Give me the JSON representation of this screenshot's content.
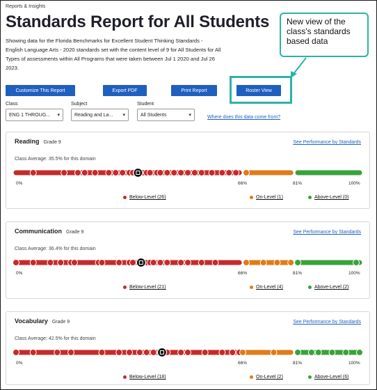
{
  "breadcrumb": "Reports & Insights",
  "title": "Standards Report for All Students",
  "description": "Showing data for the Florida Benchmarks for Excellent Student Thinking Standards - English Language Arts - 2020 standards set with the content level of 9 for All Students for All Types of assessments within All Programs that were taken between Jul 1 2020 and Jul 26 2023.",
  "callout": "New view of the class's standards based data",
  "buttons": {
    "customize": "Customize This Report",
    "export": "Export PDF",
    "print": "Print Report",
    "roster": "Roster View"
  },
  "filters": {
    "class_label": "Class",
    "class_value": "ENG 1 THROUG...",
    "subject_label": "Subject",
    "subject_value": "Reading and La...",
    "student_label": "Student",
    "student_value": "All Students",
    "data_link": "Where does this data come from?"
  },
  "colors": {
    "below": "#c62a2a",
    "on": "#e07b1a",
    "above": "#3aa23a",
    "button": "#1f5fbf",
    "callout": "#2bb3a6"
  },
  "domains": [
    {
      "name": "Reading",
      "grade": "Grade 9",
      "link": "See Performance by Standards",
      "average": "Class Average: 35.5% for this domain",
      "p0": "0%",
      "p66": "66%",
      "p81": "81%",
      "p100": "100%",
      "below": "Below-Level (26)",
      "on": "On-Level (1)",
      "above": "Above-Level (0)",
      "avg_value": 35.5,
      "scores": [
        5,
        14,
        18,
        20,
        23,
        27,
        29,
        31,
        33,
        34,
        35,
        37,
        38,
        39,
        41,
        42,
        44,
        46,
        48,
        50,
        52,
        54,
        57,
        60,
        62,
        64,
        67
      ]
    },
    {
      "name": "Communication",
      "grade": "Grade 9",
      "link": "See Performance by Standards",
      "average": "Class Average: 36.4% for this domain",
      "p0": "0%",
      "p66": "66%",
      "p81": "81%",
      "p100": "100%",
      "below": "Below-Level (21)",
      "on": "On-Level (4)",
      "above": "Above-Level (2)",
      "avg_value": 36.4,
      "scores": [
        0,
        5,
        10,
        13,
        16,
        17,
        24,
        25,
        30,
        33,
        34,
        36,
        38,
        39,
        40,
        42,
        44,
        48,
        50,
        54,
        58,
        67,
        72,
        76,
        80,
        82,
        99
      ]
    },
    {
      "name": "Vocabulary",
      "grade": "Grade 9",
      "link": "See Performance by Standards",
      "average": "Class Average: 42.5% for this domain",
      "p0": "0%",
      "p66": "66%",
      "p81": "81%",
      "p100": "100%",
      "below": "Below-Level (18)",
      "on": "On-Level (2)",
      "above": "Above-Level (6)",
      "avg_value": 42.5,
      "scores": [
        0,
        5,
        12,
        16,
        25,
        30,
        33,
        36,
        38,
        40,
        42,
        44,
        48,
        50,
        55,
        60,
        63,
        65,
        66,
        75,
        82,
        86,
        88,
        92,
        96,
        100
      ]
    }
  ]
}
